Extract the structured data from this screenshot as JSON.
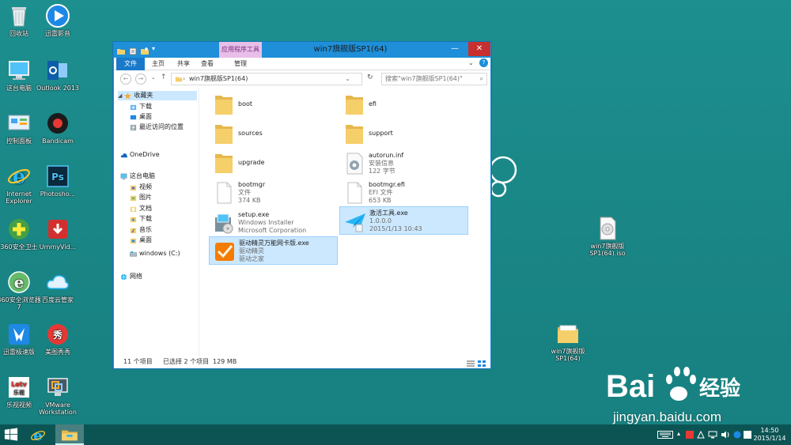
{
  "desktop": {
    "icons_left": [
      {
        "label": "回收站",
        "icon": "recycle-bin-icon"
      },
      {
        "label": "迅雷影音",
        "icon": "media-player-icon"
      },
      {
        "label": "这台电脑",
        "icon": "computer-icon"
      },
      {
        "label": "Outlook 2013",
        "icon": "outlook-icon"
      },
      {
        "label": "控制面板",
        "icon": "control-panel-icon"
      },
      {
        "label": "Bandicam",
        "icon": "bandicam-icon"
      },
      {
        "label": "Internet Explorer",
        "icon": "ie-icon"
      },
      {
        "label": "Photosho...",
        "icon": "photoshop-icon"
      },
      {
        "label": "360安全卫士",
        "icon": "security-360-icon"
      },
      {
        "label": "UmmyVid...",
        "icon": "ummy-icon"
      },
      {
        "label": "360安全浏览器7",
        "icon": "browser-360-icon"
      },
      {
        "label": "百度云管家",
        "icon": "baidu-cloud-icon"
      },
      {
        "label": "迅雷极速版",
        "icon": "thunder-icon"
      },
      {
        "label": "美图秀秀",
        "icon": "meitu-icon"
      },
      {
        "label": "乐视视频",
        "icon": "letv-icon"
      },
      {
        "label": "VMware Workstation",
        "icon": "vmware-icon"
      }
    ],
    "icon_iso": {
      "label": "win7旗舰版SP1(64).iso"
    },
    "icon_folder": {
      "label": "win7旗舰版SP1(64)"
    }
  },
  "window": {
    "title": "win7旗舰版SP1(64)",
    "context_tab": "应用程序工具",
    "ribbon_tabs": [
      "文件",
      "主页",
      "共享",
      "查看",
      "管理"
    ],
    "address": "win7旗舰版SP1(64)",
    "search_placeholder": "搜索\"win7旗舰版SP1(64)\"",
    "nav": {
      "favorites": "收藏夹",
      "fav_items": [
        "下载",
        "桌面",
        "最近访问的位置"
      ],
      "onedrive": "OneDrive",
      "this_pc": "这台电脑",
      "pc_items": [
        "视频",
        "图片",
        "文档",
        "下载",
        "音乐",
        "桌面",
        "windows (C:)"
      ],
      "network": "网络"
    },
    "files": [
      {
        "name": "boot",
        "sub1": "",
        "sub2": "",
        "type": "folder"
      },
      {
        "name": "efi",
        "sub1": "",
        "sub2": "",
        "type": "folder"
      },
      {
        "name": "sources",
        "sub1": "",
        "sub2": "",
        "type": "folder"
      },
      {
        "name": "support",
        "sub1": "",
        "sub2": "",
        "type": "folder"
      },
      {
        "name": "upgrade",
        "sub1": "",
        "sub2": "",
        "type": "folder"
      },
      {
        "name": "autorun.inf",
        "sub1": "安装信息",
        "sub2": "122 字节",
        "type": "settings"
      },
      {
        "name": "bootmgr",
        "sub1": "文件",
        "sub2": "374 KB",
        "type": "file"
      },
      {
        "name": "bootmgr.efi",
        "sub1": "EFI 文件",
        "sub2": "653 KB",
        "type": "file"
      },
      {
        "name": "setup.exe",
        "sub1": "Windows Installer",
        "sub2": "Microsoft Corporation",
        "type": "setup"
      },
      {
        "name": "激活工具.exe",
        "sub1": "1.0.0.0",
        "sub2": "2015/1/13 10:43",
        "type": "activator",
        "selected": true
      },
      {
        "name": "驱动精灵万能网卡版.exe",
        "sub1": "驱动精灵",
        "sub2": "驱动之家",
        "type": "driver",
        "selected": true
      }
    ],
    "status": {
      "count": "11 个项目",
      "selection": "已选择 2 个项目",
      "size": "129 MB"
    }
  },
  "watermark": {
    "logo_text": "Bai",
    "logo_tail": "经验",
    "url": "jingyan.baidu.com"
  },
  "taskbar": {
    "time": "14:50",
    "date": "2015/1/14"
  },
  "colors": {
    "accent": "#1e8fd8",
    "desktop": "#1a8585",
    "selection": "#cce8ff",
    "close": "#c7302e"
  }
}
